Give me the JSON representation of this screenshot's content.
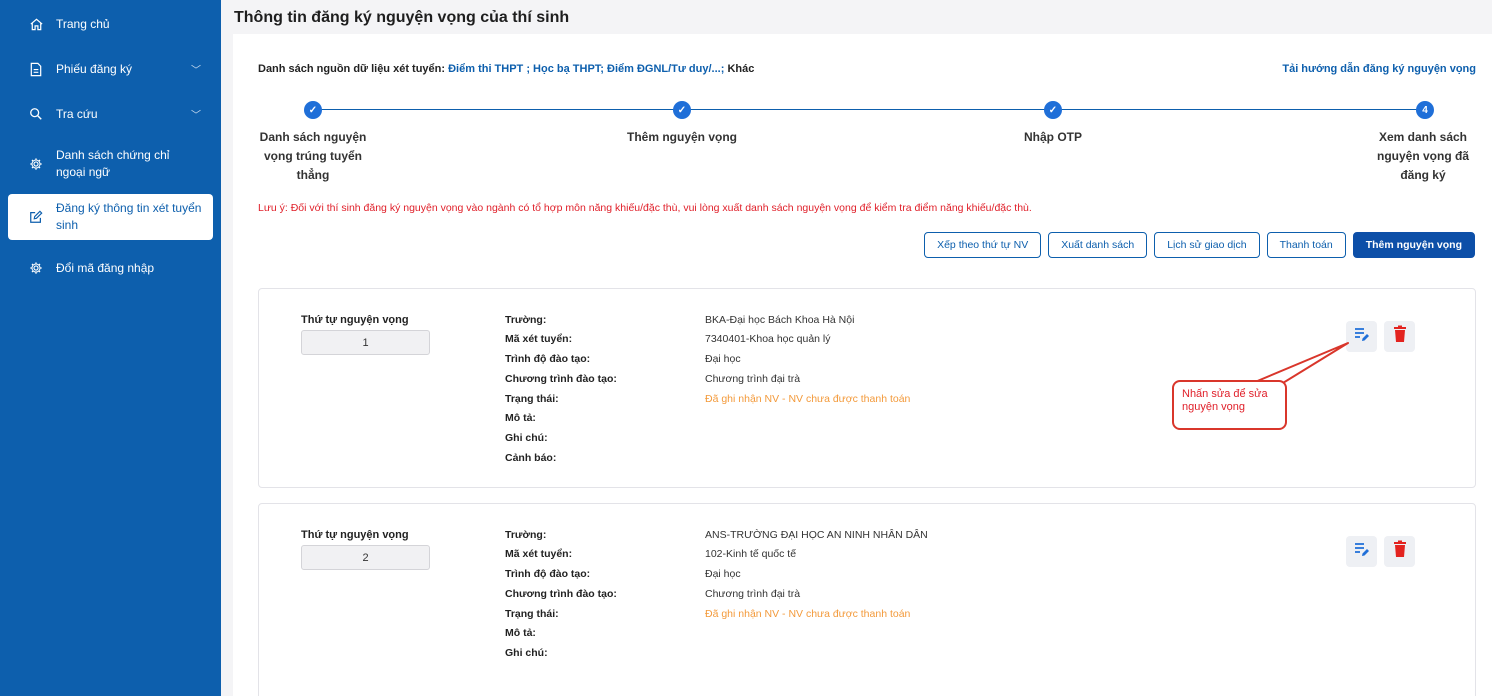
{
  "sidebar": {
    "items": [
      {
        "label": "Trang chủ",
        "icon": "home-icon"
      },
      {
        "label": "Phiếu đăng ký",
        "icon": "document-icon"
      },
      {
        "label": "Tra cứu",
        "icon": "search-icon"
      },
      {
        "label": "Danh sách chứng chỉ ngoại ngữ",
        "icon": "gear-icon"
      },
      {
        "label": "Đăng ký thông tin xét tuyển sinh",
        "icon": "edit-icon"
      },
      {
        "label": "Đổi mã đăng nhập",
        "icon": "gear-icon"
      }
    ]
  },
  "header": {
    "title": "Thông tin đăng ký nguyện vọng của thí sinh"
  },
  "sources": {
    "label": "Danh sách nguồn dữ liệu xét tuyển:",
    "links": "Điểm thi THPT ; Học bạ THPT; Điểm ĐGNL/Tư duy/...;",
    "other": "Khác"
  },
  "guide_link": "Tải hướng dẫn đăng ký nguyện vọng",
  "steps": [
    {
      "label": "Danh sách nguyện vọng trúng tuyển thẳng",
      "mark": "✓"
    },
    {
      "label": "Thêm nguyện vọng",
      "mark": "✓"
    },
    {
      "label": "Nhập OTP",
      "mark": "✓"
    },
    {
      "label": "Xem danh sách nguyện vọng đã đăng ký",
      "mark": "4"
    }
  ],
  "note": "Lưu ý: Đối với thí sinh đăng ký nguyện vọng vào ngành có tổ hợp môn năng khiếu/đặc thù, vui lòng xuất danh sách nguyện vọng để kiểm tra điểm năng khiếu/đặc thù.",
  "buttons": {
    "sort": "Xếp theo thứ tự NV",
    "export": "Xuất danh sách",
    "history": "Lịch sử giao dịch",
    "pay": "Thanh toán",
    "add": "Thêm nguyện vọng"
  },
  "field_labels": {
    "order": "Thứ tự nguyện vọng",
    "school": "Trường:",
    "code": "Mã xét tuyển:",
    "level": "Trình độ đào tạo:",
    "program": "Chương trình đào tạo:",
    "status": "Trạng thái:",
    "desc": "Mô tả:",
    "note": "Ghi chú:",
    "warning": "Cảnh báo:"
  },
  "wishes": [
    {
      "order": "1",
      "school": "BKA-Đại học Bách Khoa Hà Nội",
      "code": "7340401-Khoa học quản lý",
      "level": "Đại học",
      "program": "Chương trình đại trà",
      "status": "Đã ghi nhận NV - NV chưa được thanh toán"
    },
    {
      "order": "2",
      "school": "ANS-TRƯỜNG ĐẠI HỌC AN NINH NHÂN DÂN",
      "code": "102-Kinh tế quốc tế",
      "level": "Đại học",
      "program": "Chương trình đại trà",
      "status": "Đã ghi nhận NV - NV chưa được thanh toán"
    }
  ],
  "callout": "Nhấn sửa để sửa nguyện vọng",
  "colors": {
    "sidebar": "#0d5fad",
    "accent": "#1f6fd8",
    "primary_button": "#0d4fa8",
    "note_red": "#e0202a",
    "status_orange": "#f39a3b",
    "delete_red": "#e3231f"
  }
}
